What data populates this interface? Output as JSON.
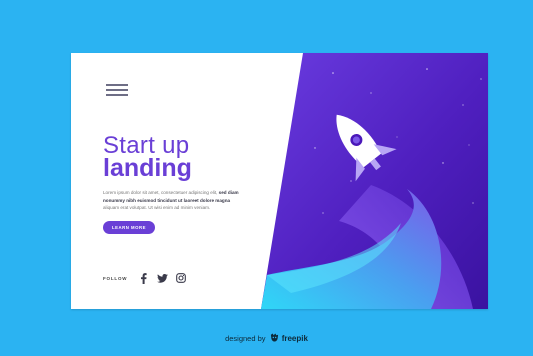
{
  "hero": {
    "title_line1": "Start up",
    "title_line2": "landing",
    "description_plain_1": "Lorem ipsum dolor sit amet, consectetuer adipiscing elit, ",
    "description_bold_1": "sed diam nonummy nibh euismod tincidunt ut laoreet dolore magna",
    "description_plain_2": " aliquam erat volutpat. Ut wisi enim ad minim veniam.",
    "cta_label": "LEARN MORE"
  },
  "nav": {
    "menu_icon": "hamburger-icon"
  },
  "social": {
    "follow_label": "FOLLOW",
    "icons": [
      "facebook-icon",
      "twitter-icon",
      "instagram-icon"
    ]
  },
  "illustration": {
    "icon": "rocket-icon"
  },
  "credit": {
    "prefix": "designed by",
    "brand": "freepik",
    "icon": "freepik-logo-icon"
  },
  "colors": {
    "page_background": "#2bb3f2",
    "accent_purple": "#6a3fd6",
    "deep_purple": "#4b18b9",
    "cyan": "#28d0f5"
  }
}
